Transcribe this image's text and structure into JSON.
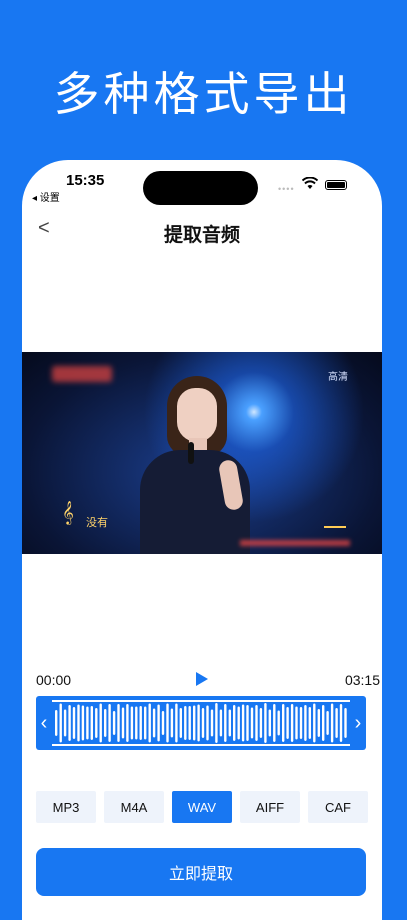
{
  "headline": "多种格式导出",
  "status": {
    "time": "15:35",
    "back_app": "◂ 设置",
    "dots": "••••"
  },
  "nav": {
    "back_glyph": "<",
    "title": "提取音频"
  },
  "video": {
    "hd_label": "高清",
    "lyric": "没有"
  },
  "player": {
    "current_time": "00:00",
    "duration": "03:15"
  },
  "formats": [
    {
      "label": "MP3",
      "active": false
    },
    {
      "label": "M4A",
      "active": false
    },
    {
      "label": "WAV",
      "active": true
    },
    {
      "label": "AIFF",
      "active": false
    },
    {
      "label": "CAF",
      "active": false
    }
  ],
  "extract_button": "立即提取",
  "colors": {
    "accent": "#1877f2",
    "format_bg": "#eef3fb"
  }
}
